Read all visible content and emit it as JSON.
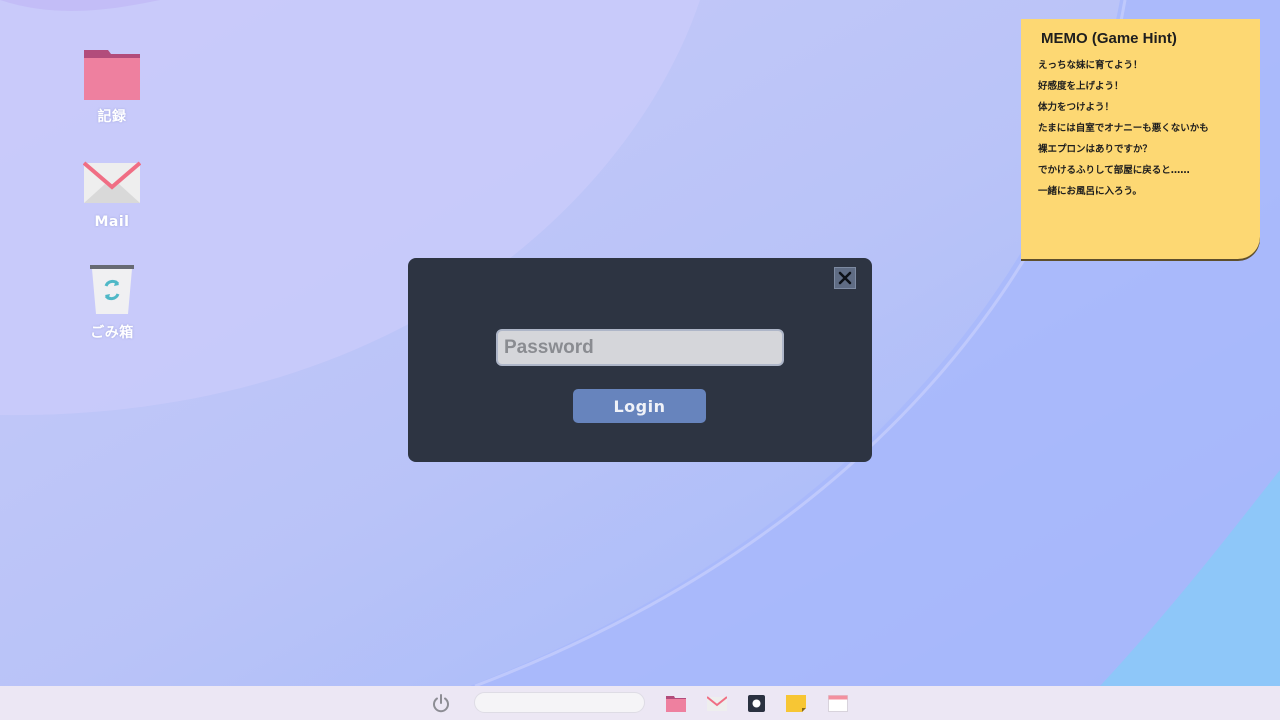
{
  "desktop": {
    "icons": [
      {
        "label": "記録",
        "icon": "folder-icon"
      },
      {
        "label": "Mail",
        "icon": "mail-icon"
      },
      {
        "label": "ごみ箱",
        "icon": "trash-icon"
      }
    ]
  },
  "memo": {
    "title": "MEMO (Game Hint)",
    "lines": [
      "えっちな妹に育てよう！",
      "好感度を上げよう！",
      "体力をつけよう！",
      "たまには自室でオナニーも悪くないかも",
      "裸エプロンはありですか？",
      "でかけるふりして部屋に戻ると……",
      "一緒にお風呂に入ろう。"
    ]
  },
  "dialog": {
    "password_placeholder": "Password",
    "login_label": "Login",
    "close_icon": "close-icon"
  },
  "taskbar": {
    "search_value": "",
    "items": [
      "power-icon",
      "folder-icon",
      "mail-icon",
      "app-icon",
      "memo-icon",
      "window-icon"
    ]
  },
  "colors": {
    "background": "#b7c2f6",
    "dialog": "#2d3442",
    "login_button": "#6784bd",
    "memo": "#fdd873",
    "taskbar": "#ece7f4"
  }
}
